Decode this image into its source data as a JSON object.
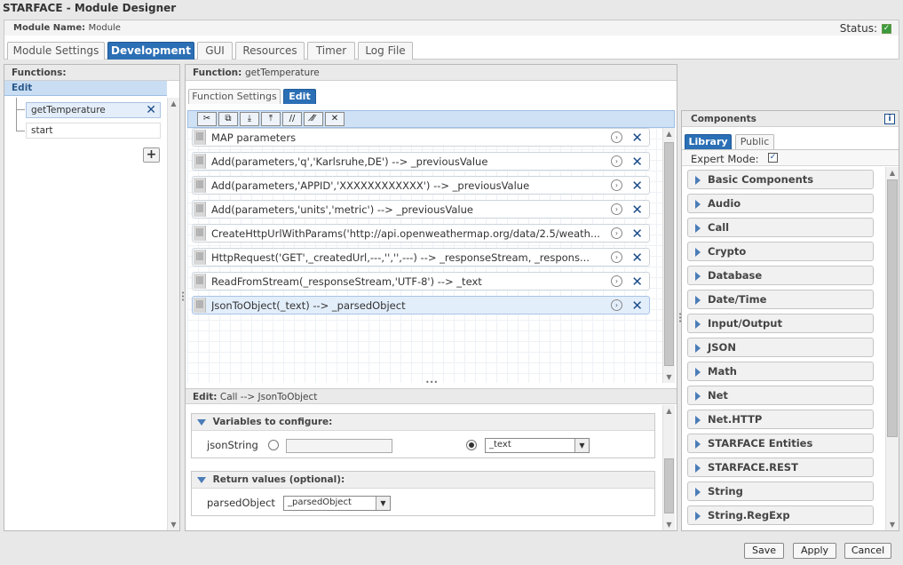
{
  "window": {
    "title": "STARFACE - Module Designer"
  },
  "module": {
    "name_label": "Module Name:",
    "name_value": "Module",
    "status_label": "Status:",
    "status_check": "✓"
  },
  "main_tabs": [
    "Module Settings",
    "Development",
    "GUI",
    "Resources",
    "Timer",
    "Log File"
  ],
  "functions_panel": {
    "header": "Functions:",
    "edit_label": "Edit",
    "items": [
      "getTemperature",
      "start"
    ],
    "add_label": "+"
  },
  "function_panel": {
    "header_label": "Function:",
    "header_value": "getTemperature",
    "tabs": [
      "Function Settings",
      "Edit"
    ],
    "toolbar_icons": [
      "✂",
      "⧉",
      "⤓",
      "⤒",
      "//",
      "⁄⁄̸",
      "✕"
    ]
  },
  "code_rows": [
    "MAP parameters",
    "Add(parameters,'q','Karlsruhe,DE') --> _previousValue",
    "Add(parameters,'APPID','XXXXXXXXXXXX') --> _previousValue",
    "Add(parameters,'units','metric') --> _previousValue",
    "CreateHttpUrlWithParams('http://api.openweathermap.org/data/2.5/weath...",
    "HttpRequest('GET',_createdUrl,---,'','',---) --> _responseStream, _respons...",
    "ReadFromStream(_responseStream,'UTF-8') --> _text",
    "JsonToObject(_text) --> _parsedObject"
  ],
  "edit_panel": {
    "header_label": "Edit:",
    "header_value": "Call --> JsonToObject",
    "variables_header": "Variables to configure:",
    "var_name": "jsonString",
    "var_text_value": "",
    "var_select_value": "_text",
    "return_header": "Return values (optional):",
    "return_name": "parsedObject",
    "return_select_value": "_parsedObject"
  },
  "components": {
    "header": "Components",
    "tabs": [
      "Library",
      "Public"
    ],
    "expert_label": "Expert Mode:",
    "expert_check": "✓",
    "items": [
      "Basic Components",
      "Audio",
      "Call",
      "Crypto",
      "Database",
      "Date/Time",
      "Input/Output",
      "JSON",
      "Math",
      "Net",
      "Net.HTTP",
      "STARFACE Entities",
      "STARFACE.REST",
      "String",
      "String.RegExp"
    ]
  },
  "buttons": {
    "save": "Save",
    "apply": "Apply",
    "cancel": "Cancel"
  }
}
